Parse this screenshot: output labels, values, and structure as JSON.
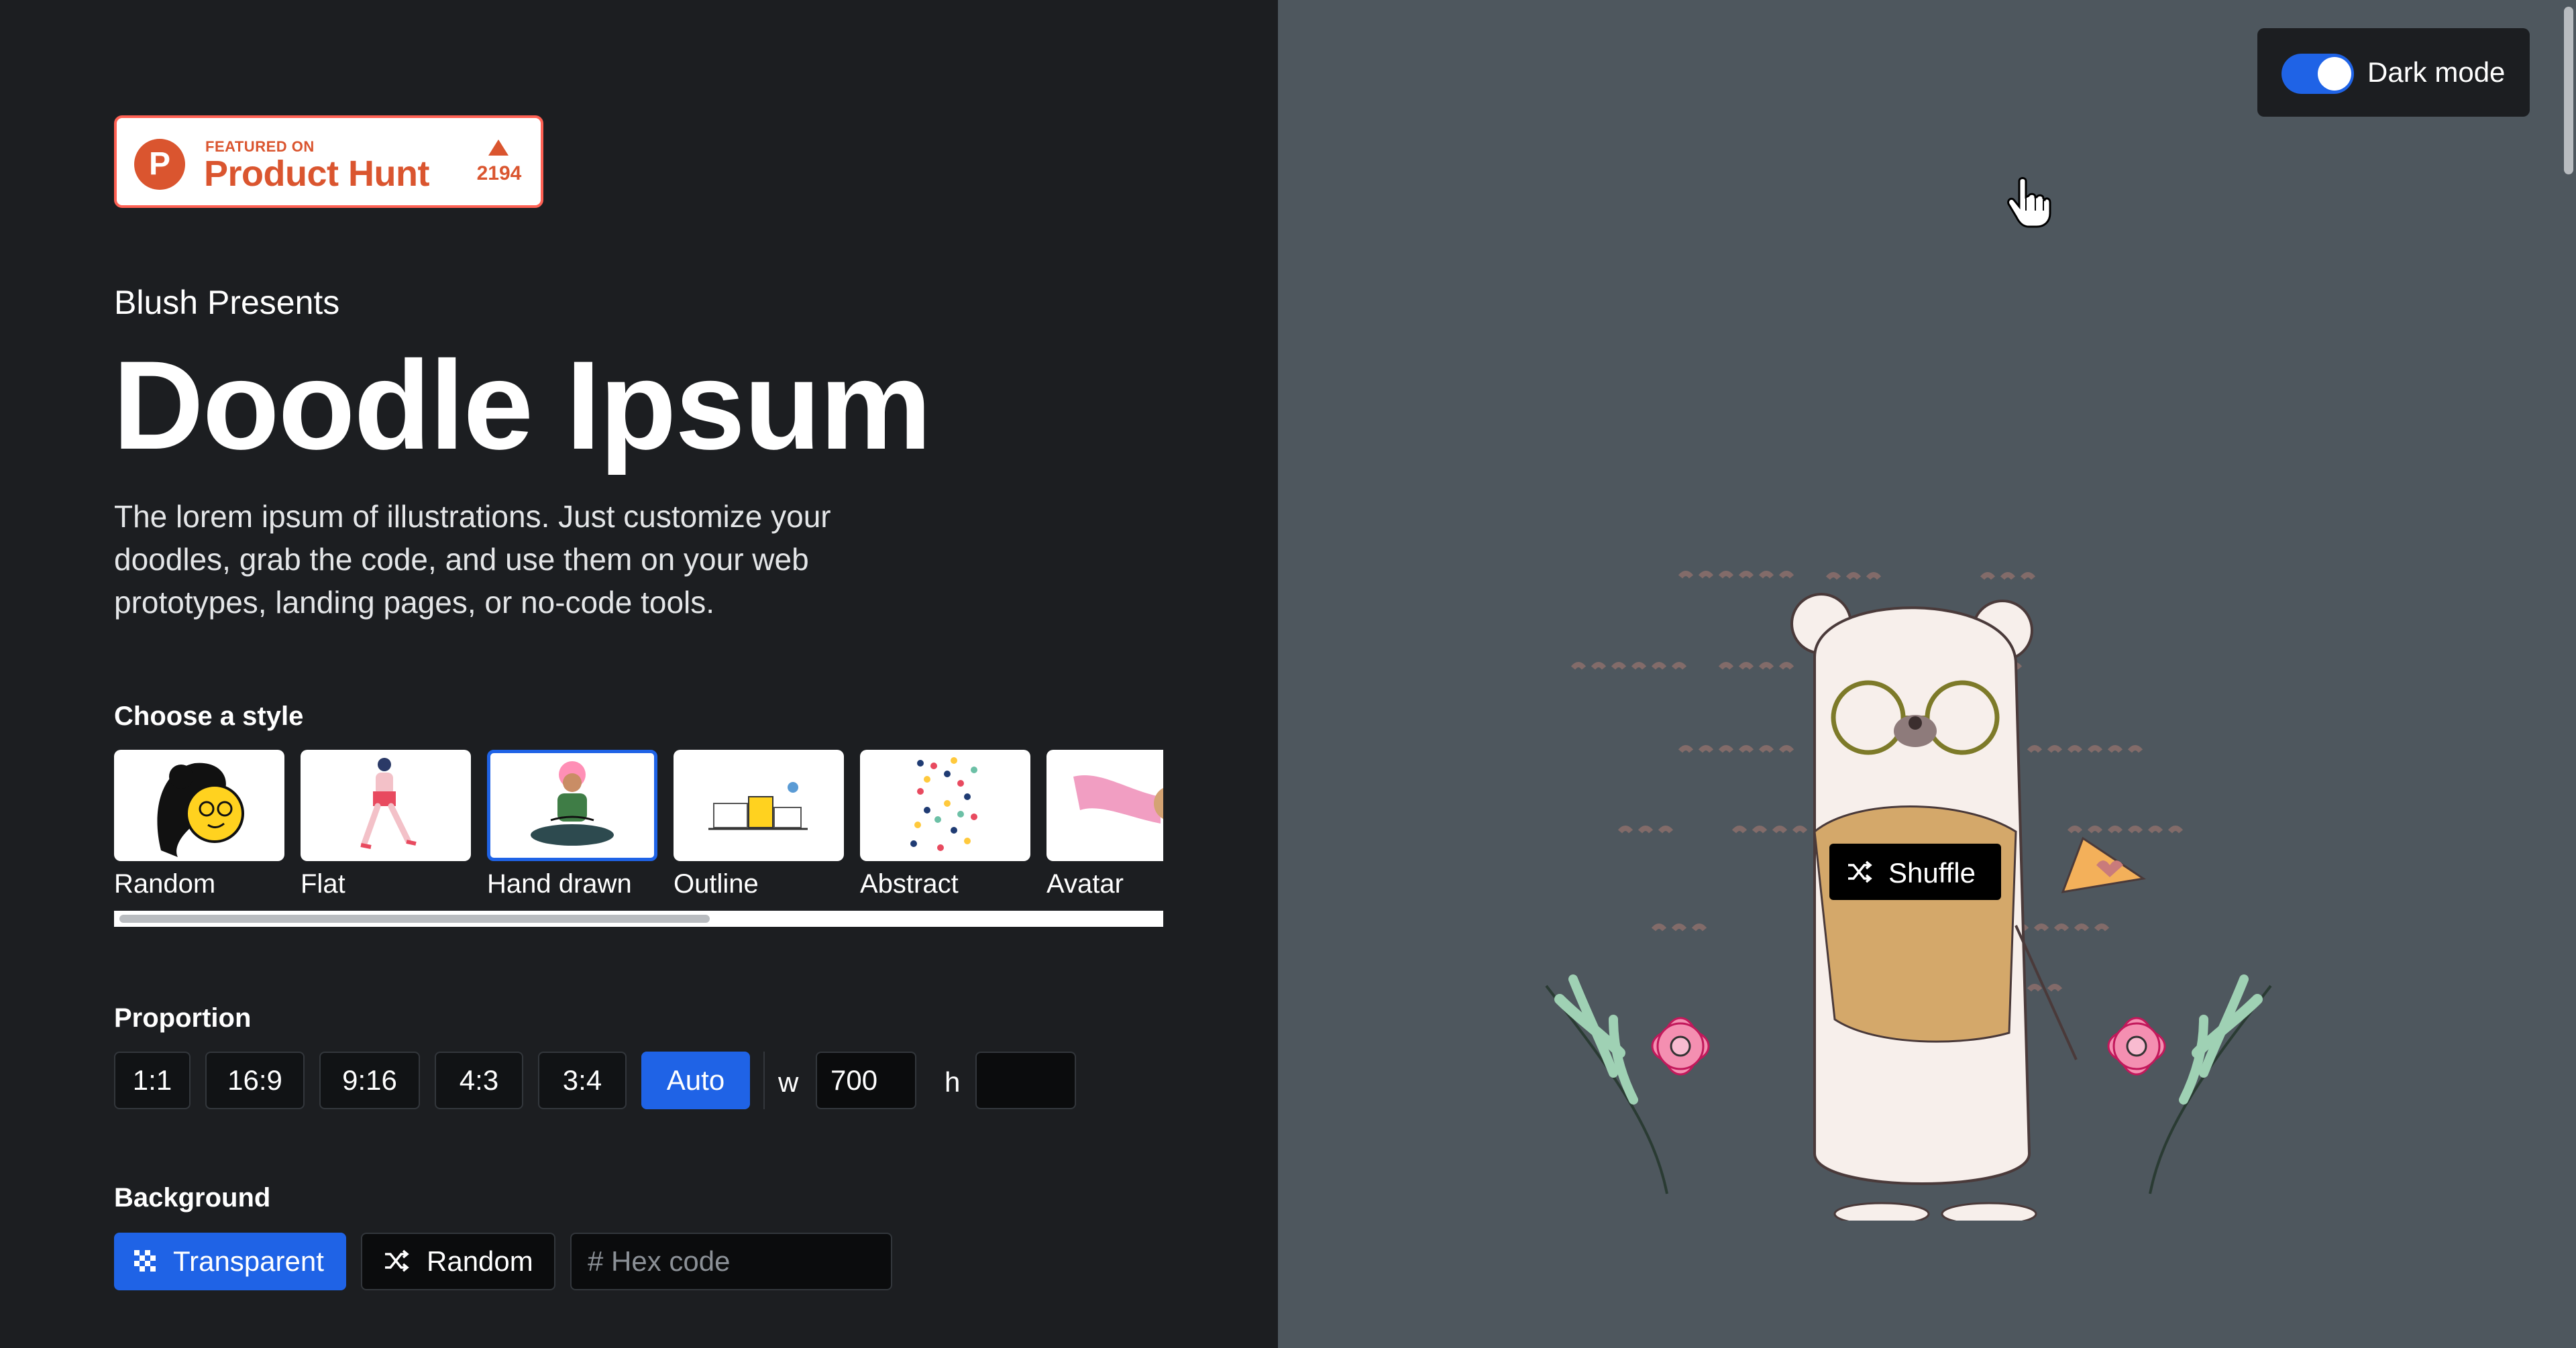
{
  "product_hunt": {
    "featured_on": "FEATURED ON",
    "name": "Product Hunt",
    "logo_letter": "P",
    "upvotes": "2194",
    "brand_color": "#da552f"
  },
  "hero": {
    "eyebrow": "Blush Presents",
    "title": "Doodle Ipsum",
    "description": "The lorem ipsum of illustrations. Just customize your doodles, grab the code, and use them on your web prototypes, landing pages, or no-code tools."
  },
  "style_picker": {
    "label": "Choose a style",
    "selected": "Hand drawn",
    "styles": [
      {
        "label": "Random"
      },
      {
        "label": "Flat"
      },
      {
        "label": "Hand drawn"
      },
      {
        "label": "Outline"
      },
      {
        "label": "Abstract"
      },
      {
        "label": "Avatar"
      }
    ]
  },
  "proportion": {
    "label": "Proportion",
    "options": [
      "1:1",
      "16:9",
      "9:16",
      "4:3",
      "3:4",
      "Auto"
    ],
    "selected": "Auto",
    "width_label": "w",
    "width_value": "700",
    "height_label": "h",
    "height_value": ""
  },
  "background": {
    "label": "Background",
    "transparent_label": "Transparent",
    "random_label": "Random",
    "hex_placeholder": "# Hex code"
  },
  "preview": {
    "dark_mode_label": "Dark mode",
    "dark_mode_on": true,
    "shuffle_label": "Shuffle",
    "canvas_color": "#4e575e"
  },
  "colors": {
    "accent": "#1f63e6",
    "panel_dark": "#1c1e21"
  }
}
